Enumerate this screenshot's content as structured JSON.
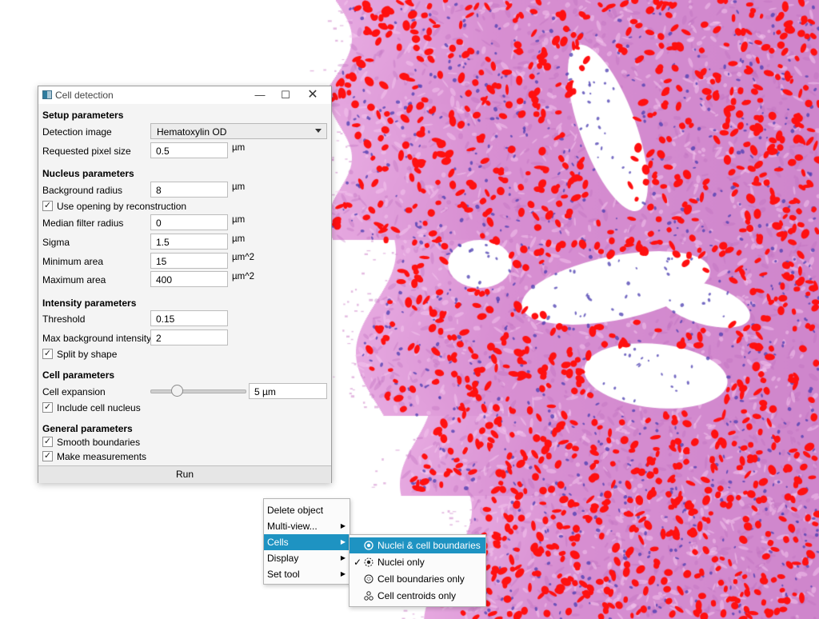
{
  "dialog": {
    "title": "Cell detection",
    "window_buttons": {
      "minimize": "—",
      "maximize": "☐",
      "close": "✕"
    },
    "setup": {
      "heading": "Setup parameters",
      "detection_image_label": "Detection image",
      "detection_image_value": "Hematoxylin OD",
      "pixel_size_label": "Requested pixel size",
      "pixel_size_value": "0.5",
      "pixel_size_unit": "µm"
    },
    "nucleus": {
      "heading": "Nucleus parameters",
      "background_radius_label": "Background radius",
      "background_radius_value": "8",
      "background_radius_unit": "µm",
      "opening_label": "Use opening by reconstruction",
      "opening_checked": true,
      "median_label": "Median filter radius",
      "median_value": "0",
      "median_unit": "µm",
      "sigma_label": "Sigma",
      "sigma_value": "1.5",
      "sigma_unit": "µm",
      "min_area_label": "Minimum area",
      "min_area_value": "15",
      "min_area_unit": "µm^2",
      "max_area_label": "Maximum area",
      "max_area_value": "400",
      "max_area_unit": "µm^2"
    },
    "intensity": {
      "heading": "Intensity parameters",
      "threshold_label": "Threshold",
      "threshold_value": "0.15",
      "max_bg_label": "Max background intensity",
      "max_bg_value": "2",
      "split_label": "Split by shape",
      "split_checked": true
    },
    "cell": {
      "heading": "Cell parameters",
      "expansion_label": "Cell expansion",
      "expansion_value": "5 µm",
      "expansion_slider_fraction": 0.25,
      "include_nucleus_label": "Include cell nucleus",
      "include_nucleus_checked": true
    },
    "general": {
      "heading": "General parameters",
      "smooth_label": "Smooth boundaries",
      "smooth_checked": true,
      "measure_label": "Make measurements",
      "measure_checked": true
    },
    "run_label": "Run"
  },
  "context_menu": {
    "items": [
      {
        "label": "Delete object",
        "submenu": false,
        "selected": false
      },
      {
        "label": "Multi-view...",
        "submenu": true,
        "selected": false
      },
      {
        "label": "Cells",
        "submenu": true,
        "selected": true
      },
      {
        "label": "Display",
        "submenu": true,
        "selected": false
      },
      {
        "label": "Set tool",
        "submenu": true,
        "selected": false
      }
    ]
  },
  "cells_submenu": {
    "items": [
      {
        "label": "Nuclei & cell boundaries",
        "icon": "nuclei-boundaries-icon",
        "checked": false,
        "highlighted": true
      },
      {
        "label": "Nuclei only",
        "icon": "nuclei-only-icon",
        "checked": true,
        "highlighted": false
      },
      {
        "label": "Cell boundaries only",
        "icon": "cell-boundaries-icon",
        "checked": false,
        "highlighted": false
      },
      {
        "label": "Cell centroids only",
        "icon": "cell-centroids-icon",
        "checked": false,
        "highlighted": false
      }
    ]
  },
  "colors": {
    "accent": "#1e93c2",
    "tissue": "#d28ccf",
    "nuclei": "#ff1010",
    "hematoxylin": "#4a3cb0"
  }
}
